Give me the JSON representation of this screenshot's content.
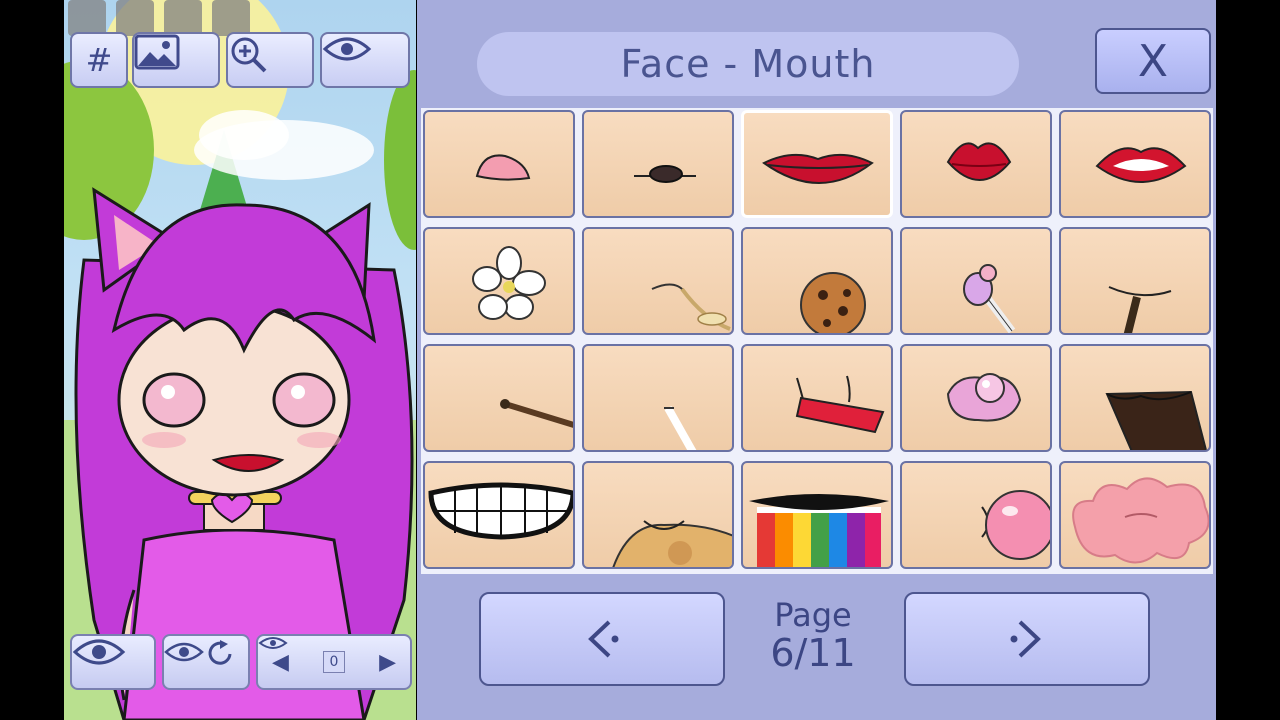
{
  "panel": {
    "title": "Face - Mouth",
    "close_label": "X",
    "page_label": "Page",
    "page_value": "6/11",
    "prev_symbol": "‹",
    "next_symbol": "›"
  },
  "preview_toolbar": {
    "hash_label": "#"
  },
  "preview_bottom": {
    "slot_value": "0"
  },
  "items": [
    {
      "name": "pink-tongue-mouth-icon"
    },
    {
      "name": "small-dark-lips-icon"
    },
    {
      "name": "wide-red-lips-icon"
    },
    {
      "name": "pouty-red-lips-icon"
    },
    {
      "name": "open-red-lips-icon"
    },
    {
      "name": "flower-in-mouth-icon"
    },
    {
      "name": "wheat-stalk-icon"
    },
    {
      "name": "cookie-icon"
    },
    {
      "name": "lollipop-icon"
    },
    {
      "name": "dark-stick-icon"
    },
    {
      "name": "stick-in-mouth-icon"
    },
    {
      "name": "white-straw-icon"
    },
    {
      "name": "red-candy-icon"
    },
    {
      "name": "pink-pastry-icon"
    },
    {
      "name": "chocolate-bar-icon"
    },
    {
      "name": "grinning-teeth-icon"
    },
    {
      "name": "toast-bread-icon"
    },
    {
      "name": "rainbow-puke-icon"
    },
    {
      "name": "bubble-gum-icon"
    },
    {
      "name": "pink-splat-icon"
    }
  ],
  "colors": {
    "panel_bg": "#a6acdc",
    "cell_bg": "#f3d3b3",
    "accent_text": "#4a5590",
    "hair": "#c23bd8",
    "lips": "#c8102e"
  }
}
